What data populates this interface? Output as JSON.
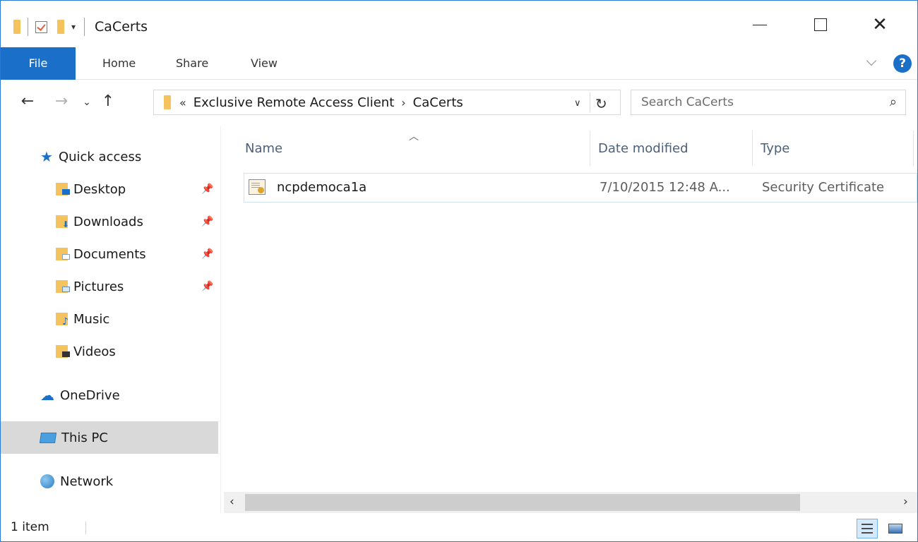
{
  "window": {
    "title": "CaCerts"
  },
  "ribbon": {
    "tabs": [
      {
        "label": "File"
      },
      {
        "label": "Home"
      },
      {
        "label": "Share"
      },
      {
        "label": "View"
      }
    ],
    "help_label": "?"
  },
  "address_bar": {
    "overflow_label": "«",
    "breadcrumbs": [
      {
        "label": "Exclusive Remote Access Client"
      },
      {
        "label": "CaCerts"
      }
    ]
  },
  "search": {
    "placeholder": "Search CaCerts"
  },
  "nav_pane": {
    "quick_access": {
      "label": "Quick access",
      "icon": "star-icon"
    },
    "items": [
      {
        "label": "Desktop",
        "icon": "desktop-folder-icon",
        "pinned": true
      },
      {
        "label": "Downloads",
        "icon": "downloads-folder-icon",
        "pinned": true
      },
      {
        "label": "Documents",
        "icon": "documents-folder-icon",
        "pinned": true
      },
      {
        "label": "Pictures",
        "icon": "pictures-folder-icon",
        "pinned": true
      },
      {
        "label": "Music",
        "icon": "music-folder-icon",
        "pinned": false
      },
      {
        "label": "Videos",
        "icon": "videos-folder-icon",
        "pinned": false
      }
    ],
    "onedrive": {
      "label": "OneDrive",
      "icon": "onedrive-cloud-icon"
    },
    "this_pc": {
      "label": "This PC",
      "icon": "computer-icon",
      "selected": true
    },
    "network": {
      "label": "Network",
      "icon": "network-icon"
    }
  },
  "file_list": {
    "columns": [
      {
        "label": "Name",
        "sorted": "ascending"
      },
      {
        "label": "Date modified"
      },
      {
        "label": "Type"
      }
    ],
    "rows": [
      {
        "name": "ncpdemoca1a",
        "date_modified": "7/10/2015 12:48 A...",
        "type": "Security Certificate",
        "icon": "certificate-icon"
      }
    ]
  },
  "status_bar": {
    "item_count": "1 item",
    "view_mode": "details"
  },
  "colors": {
    "accent": "#1a6fc9",
    "window_border": "#2b79d6",
    "selection": "#d9d9d9",
    "column_header_text": "#4c607a"
  }
}
